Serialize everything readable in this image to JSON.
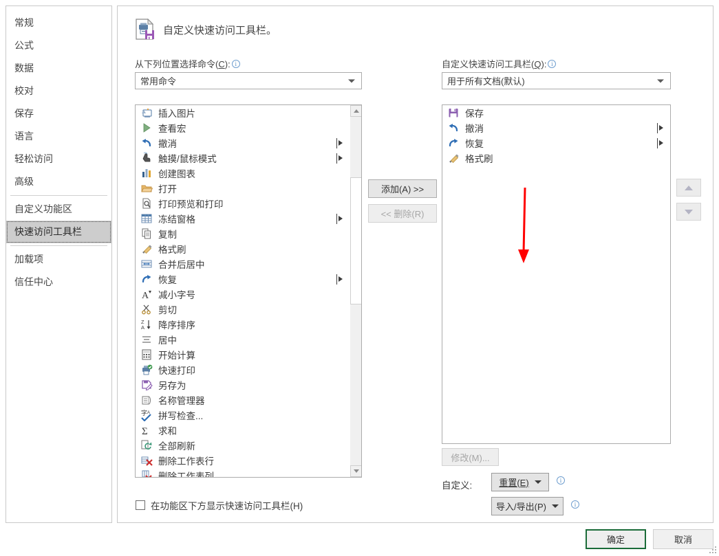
{
  "sidebar": {
    "items": [
      {
        "label": "常规",
        "selected": false,
        "sep_after": false
      },
      {
        "label": "公式",
        "selected": false,
        "sep_after": false
      },
      {
        "label": "数据",
        "selected": false,
        "sep_after": false
      },
      {
        "label": "校对",
        "selected": false,
        "sep_after": false
      },
      {
        "label": "保存",
        "selected": false,
        "sep_after": false
      },
      {
        "label": "语言",
        "selected": false,
        "sep_after": false
      },
      {
        "label": "轻松访问",
        "selected": false,
        "sep_after": false
      },
      {
        "label": "高级",
        "selected": false,
        "sep_after": true
      },
      {
        "label": "自定义功能区",
        "selected": false,
        "sep_after": false
      },
      {
        "label": "快速访问工具栏",
        "selected": true,
        "sep_after": true
      },
      {
        "label": "加载项",
        "selected": false,
        "sep_after": false
      },
      {
        "label": "信任中心",
        "selected": false,
        "sep_after": false
      }
    ]
  },
  "header": {
    "title": "自定义快速访问工具栏。",
    "icon": "document-print-save-icon"
  },
  "left_section": {
    "label_text": "从下列位置选择命令",
    "label_accel": "C",
    "info_icon": "info-icon",
    "combo_value": "常用命令",
    "items": [
      {
        "label": "插入图片",
        "icon": "insert-picture-icon",
        "submenu": false
      },
      {
        "label": "查看宏",
        "icon": "view-macros-icon",
        "submenu": false
      },
      {
        "label": "撤消",
        "icon": "undo-icon",
        "submenu": true
      },
      {
        "label": "触摸/鼠标模式",
        "icon": "touch-mouse-mode-icon",
        "submenu": true
      },
      {
        "label": "创建图表",
        "icon": "create-chart-icon",
        "submenu": false
      },
      {
        "label": "打开",
        "icon": "open-folder-icon",
        "submenu": false
      },
      {
        "label": "打印预览和打印",
        "icon": "print-preview-icon",
        "submenu": false
      },
      {
        "label": "冻结窗格",
        "icon": "freeze-panes-icon",
        "submenu": true
      },
      {
        "label": "复制",
        "icon": "copy-icon",
        "submenu": false
      },
      {
        "label": "格式刷",
        "icon": "format-painter-icon",
        "submenu": false
      },
      {
        "label": "合并后居中",
        "icon": "merge-center-icon",
        "submenu": false
      },
      {
        "label": "恢复",
        "icon": "redo-icon",
        "submenu": true
      },
      {
        "label": "减小字号",
        "icon": "decrease-font-size-icon",
        "submenu": false
      },
      {
        "label": "剪切",
        "icon": "cut-scissors-icon",
        "submenu": false
      },
      {
        "label": "降序排序",
        "icon": "sort-descending-icon",
        "submenu": false
      },
      {
        "label": "居中",
        "icon": "align-center-icon",
        "submenu": false
      },
      {
        "label": "开始计算",
        "icon": "calculate-now-icon",
        "submenu": false
      },
      {
        "label": "快速打印",
        "icon": "quick-print-icon",
        "submenu": false
      },
      {
        "label": "另存为",
        "icon": "save-as-icon",
        "submenu": false
      },
      {
        "label": "名称管理器",
        "icon": "name-manager-icon",
        "submenu": false
      },
      {
        "label": "拼写检查...",
        "icon": "spelling-check-icon",
        "submenu": false
      },
      {
        "label": "求和",
        "icon": "autosum-icon",
        "submenu": false
      },
      {
        "label": "全部刷新",
        "icon": "refresh-all-icon",
        "submenu": false
      },
      {
        "label": "删除工作表行",
        "icon": "delete-sheet-rows-icon",
        "submenu": false
      },
      {
        "label": "删除工作表列",
        "icon": "delete-sheet-columns-icon",
        "submenu": false
      }
    ]
  },
  "right_section": {
    "label_text": "自定义快速访问工具栏",
    "label_accel": "Q",
    "info_icon": "info-icon",
    "combo_value": "用于所有文档(默认)",
    "items": [
      {
        "label": "保存",
        "icon": "save-floppy-icon",
        "submenu": false
      },
      {
        "label": "撤消",
        "icon": "undo-icon",
        "submenu": true
      },
      {
        "label": "恢复",
        "icon": "redo-icon",
        "submenu": true
      },
      {
        "label": "格式刷",
        "icon": "format-painter-icon",
        "submenu": false
      }
    ]
  },
  "middle_buttons": {
    "add": "添加(A) >>",
    "remove": "<< 删除(R)"
  },
  "reorder_buttons": {
    "up": "move-up-icon",
    "down": "move-down-icon"
  },
  "bottom_right": {
    "modify": "修改(M)...",
    "custom_label": "自定义:",
    "reset": "重置(E)",
    "import_export": "导入/导出(P)"
  },
  "bottom_left": {
    "checkbox_label": "在功能区下方显示快速访问工具栏(H)",
    "checked": false
  },
  "dialog_buttons": {
    "ok": "确定",
    "cancel": "取消"
  },
  "annotation": {
    "arrow_color": "#ff0000",
    "points_to": "添加(A) >>"
  }
}
